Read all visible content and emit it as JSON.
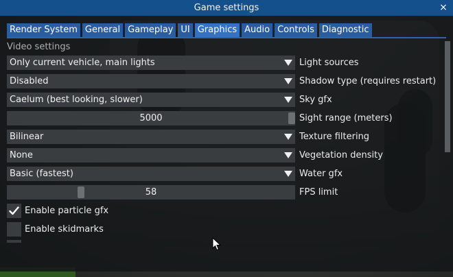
{
  "window": {
    "title": "Game settings",
    "close_label": "×"
  },
  "tabs": [
    {
      "label": "Render System"
    },
    {
      "label": "General"
    },
    {
      "label": "Gameplay"
    },
    {
      "label": "UI"
    },
    {
      "label": "Graphics",
      "active": true
    },
    {
      "label": "Audio"
    },
    {
      "label": "Controls"
    },
    {
      "label": "Diagnostic"
    }
  ],
  "section": {
    "title": "Video settings"
  },
  "settings": [
    {
      "type": "dropdown",
      "value": "Only current vehicle, main lights",
      "label": "Light sources"
    },
    {
      "type": "dropdown",
      "value": "Disabled",
      "label": "Shadow type (requires restart)"
    },
    {
      "type": "dropdown",
      "value": "Caelum (best looking, slower)",
      "label": "Sky gfx"
    },
    {
      "type": "slider",
      "value": "5000",
      "label": "Sight range (meters)",
      "fraction": 1.0
    },
    {
      "type": "dropdown",
      "value": "Bilinear",
      "label": "Texture filtering"
    },
    {
      "type": "dropdown",
      "value": "None",
      "label": "Vegetation density"
    },
    {
      "type": "dropdown",
      "value": "Basic (fastest)",
      "label": "Water gfx"
    },
    {
      "type": "slider",
      "value": "58",
      "label": "FPS limit",
      "fraction": 0.25
    }
  ],
  "checkboxes": [
    {
      "label": "Enable particle gfx",
      "checked": true
    },
    {
      "label": "Enable skidmarks",
      "checked": false
    }
  ],
  "colors": {
    "titlebar": "#14508c",
    "tab": "#2a5da0",
    "control_bg": "#3a3d3f"
  }
}
